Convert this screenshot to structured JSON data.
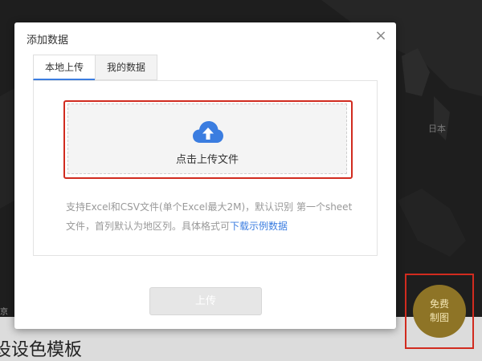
{
  "background": {
    "map_label_japan": "日本",
    "side_label": "京",
    "bottom_title": "设设色模板"
  },
  "modal": {
    "title": "添加数据",
    "close_icon": "close-icon",
    "tabs": [
      {
        "label": "本地上传",
        "active": true
      },
      {
        "label": "我的数据",
        "active": false
      }
    ],
    "upload": {
      "icon": "cloud-upload-icon",
      "label": "点击上传文件"
    },
    "description": "支持Excel和CSV文件(单个Excel最大2M)，默认识别 第一个sheet文件，首列默认为地区列。具体格式可",
    "download_link": "下载示例数据",
    "upload_button": "上传"
  },
  "free_badge": {
    "line1": "免费",
    "line2": "制图"
  },
  "colors": {
    "accent": "#3b7de0",
    "highlight": "#d12b1f",
    "badge": "#8e7426"
  }
}
